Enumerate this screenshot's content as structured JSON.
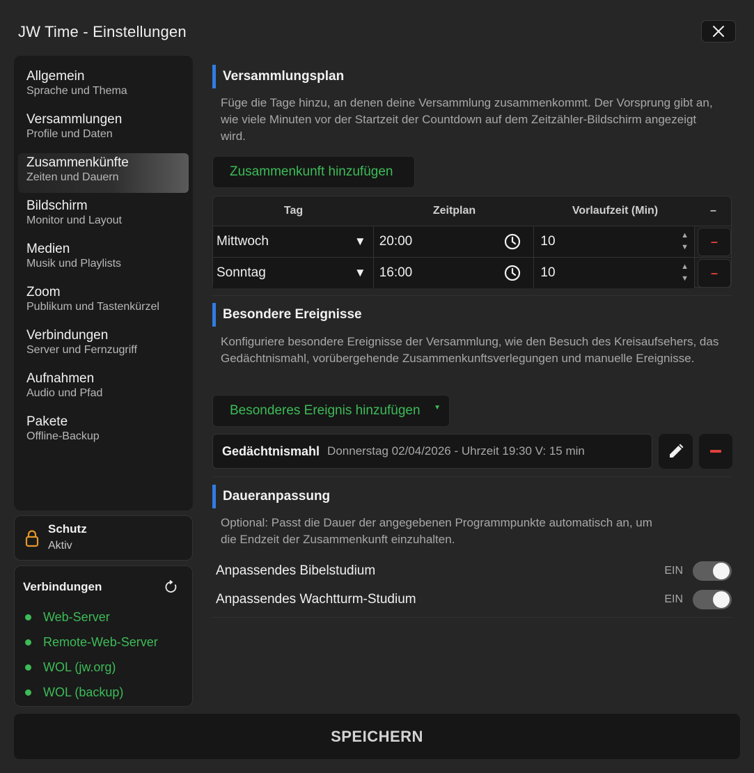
{
  "window": {
    "title": "JW Time - Einstellungen"
  },
  "sidebar": {
    "items": [
      {
        "title": "Allgemein",
        "subtitle": "Sprache und Thema"
      },
      {
        "title": "Versammlungen",
        "subtitle": "Profile und Daten"
      },
      {
        "title": "Zusammenkünfte",
        "subtitle": "Zeiten und Dauern",
        "active": true
      },
      {
        "title": "Bildschirm",
        "subtitle": "Monitor und Layout"
      },
      {
        "title": "Medien",
        "subtitle": "Musik und Playlists"
      },
      {
        "title": "Zoom",
        "subtitle": "Publikum und Tastenkürzel"
      },
      {
        "title": "Verbindungen",
        "subtitle": "Server und Fernzugriff"
      },
      {
        "title": "Aufnahmen",
        "subtitle": "Audio und Pfad"
      },
      {
        "title": "Pakete",
        "subtitle": "Offline-Backup"
      }
    ]
  },
  "protection": {
    "title": "Schutz",
    "status": "Aktiv",
    "icon": "lock-icon",
    "color": "#e7962a"
  },
  "connections": {
    "title": "Verbindungen",
    "status_color": "#3dbb57",
    "items": [
      "Web-Server",
      "Remote-Web-Server",
      "WOL (jw.org)",
      "WOL (backup)"
    ]
  },
  "schedule": {
    "title": "Versammlungsplan",
    "description": "Füge die Tage hinzu, an denen deine Versammlung zusammenkommt. Der Vorsprung gibt an, wie viele Minuten vor der Startzeit der Countdown auf dem Zeitzähler-Bildschirm angezeigt wird.",
    "add_button": "Zusammenkunft hinzufügen",
    "columns": [
      "Tag",
      "Zeitplan",
      "Vorlaufzeit (Min)",
      "–"
    ],
    "rows": [
      {
        "day": "Mittwoch",
        "time": "20:00",
        "lead": "10",
        "delete": "–"
      },
      {
        "day": "Sonntag",
        "time": "16:00",
        "lead": "10",
        "delete": "–"
      }
    ]
  },
  "events": {
    "title": "Besondere Ereignisse",
    "description": "Konfiguriere besondere Ereignisse der Versammlung, wie den Besuch des Kreisaufsehers, das Gedächtnismahl, vorübergehende Zusammenkunftsverlegungen und manuelle Ereignisse.",
    "add_button": "Besonderes Ereignis hinzufügen",
    "items": [
      {
        "name": "Gedächtnismahl",
        "details": "Donnerstag 02/04/2026 - Uhrzeit 19:30 V: 15 min"
      }
    ]
  },
  "duration": {
    "title": "Daueranpassung",
    "description": "Optional: Passt die Dauer der angegebenen Programmpunkte automatisch an, um die Endzeit der Zusammenkunft einzuhalten.",
    "toggles": [
      {
        "label": "Anpassendes Bibelstudium",
        "state": "EIN",
        "on": true
      },
      {
        "label": "Anpassendes Wachtturm-Studium",
        "state": "EIN",
        "on": true
      }
    ]
  },
  "footer": {
    "save_label": "SPEICHERN"
  },
  "colors": {
    "accent": "#2f7de1",
    "green": "#3dbb57",
    "danger": "#e0413a"
  }
}
